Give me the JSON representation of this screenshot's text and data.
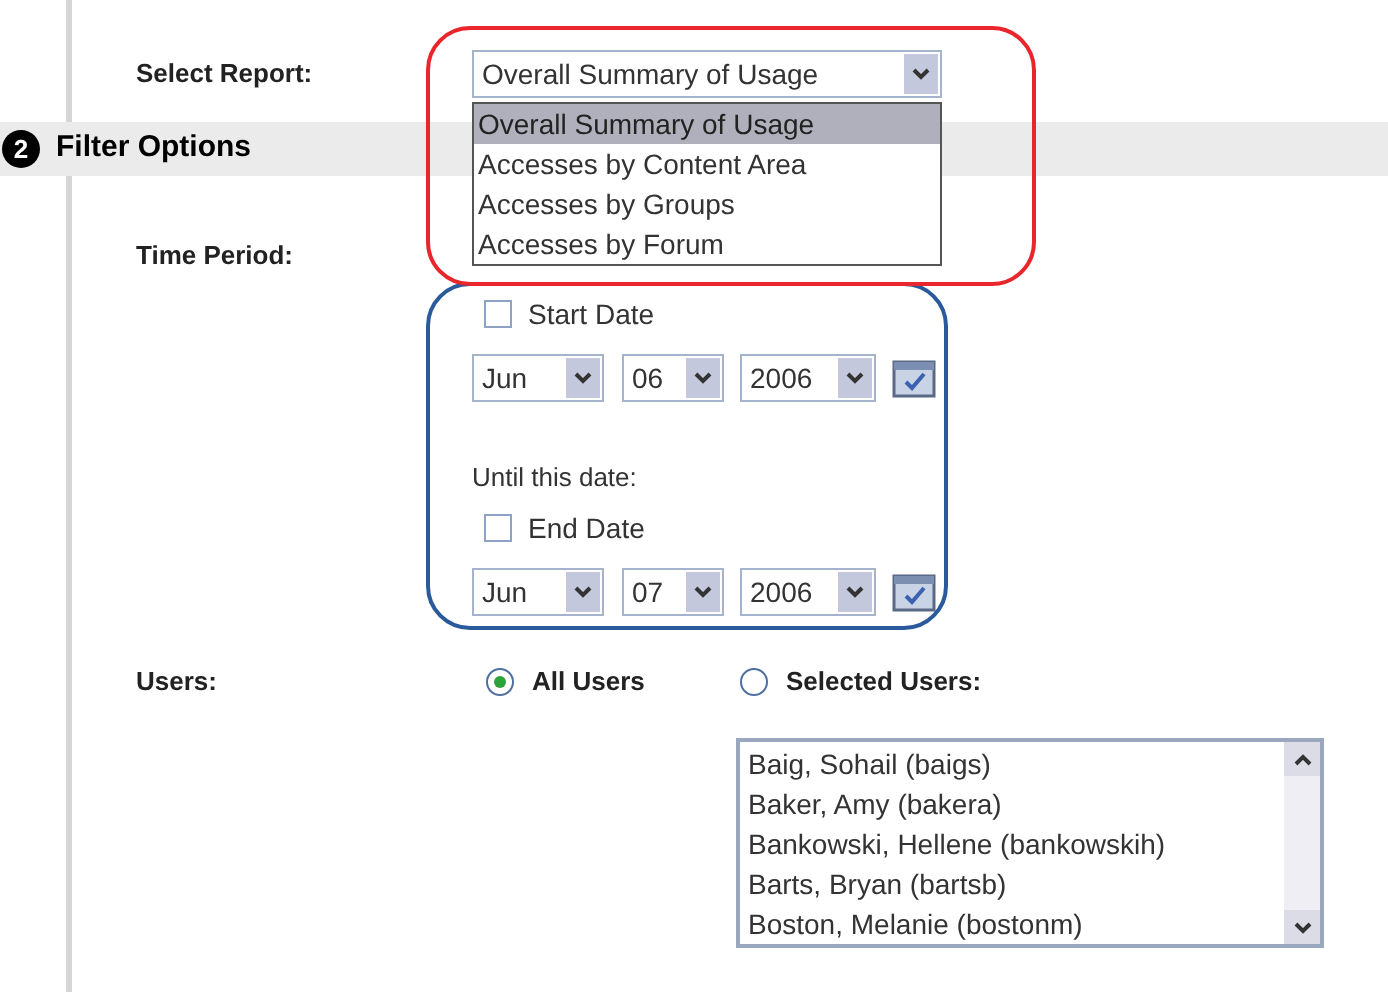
{
  "report": {
    "label": "Select Report:",
    "value": "Overall Summary of Usage",
    "options": [
      {
        "label": "Overall Summary of Usage",
        "selected": true
      },
      {
        "label": "Accesses by Content Area",
        "selected": false
      },
      {
        "label": "Accesses by Groups",
        "selected": false
      },
      {
        "label": "Accesses by Forum",
        "selected": false
      }
    ]
  },
  "section": {
    "number": "2",
    "title": "Filter Options"
  },
  "time_period": {
    "label": "Time Period:",
    "start": {
      "label": "Start Date",
      "checked": false,
      "month": "Jun",
      "day": "06",
      "year": "2006"
    },
    "until_label": "Until this date:",
    "end": {
      "label": "End Date",
      "checked": false,
      "month": "Jun",
      "day": "07",
      "year": "2006"
    }
  },
  "users": {
    "label": "Users:",
    "options": [
      {
        "label": "All Users",
        "selected": true
      },
      {
        "label": "Selected Users:",
        "selected": false
      }
    ],
    "list": [
      "Baig, Sohail (baigs)",
      "Baker, Amy (bakera)",
      "Bankowski, Hellene (bankowskih)",
      "Barts, Bryan (bartsb)",
      "Boston, Melanie (bostonm)"
    ]
  }
}
